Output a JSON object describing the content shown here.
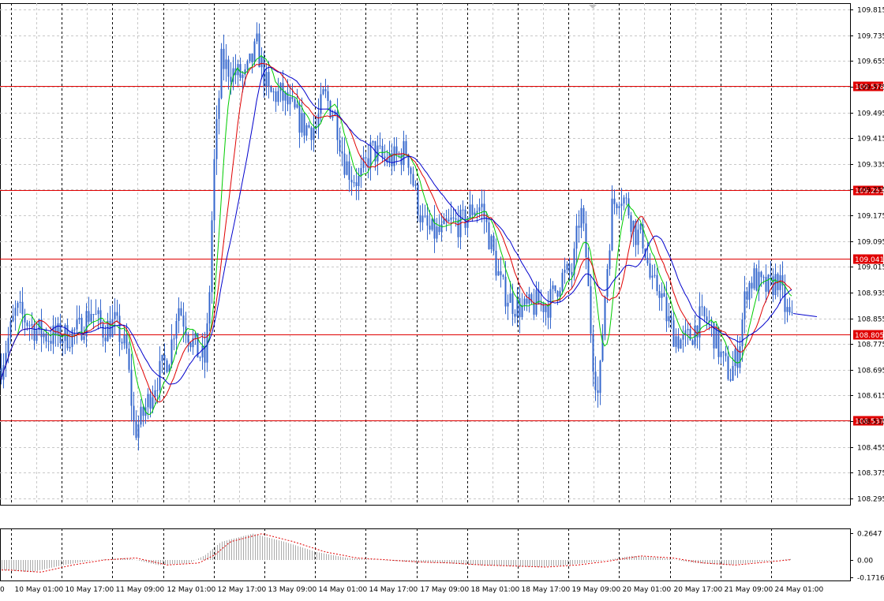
{
  "chart_data": [
    {
      "type": "candlestick",
      "instrument": "",
      "ylim": [
        108.295,
        109.815
      ],
      "y_ticks": [
        "109.815",
        "109.735",
        "109.655",
        "109.575",
        "109.495",
        "109.415",
        "109.335",
        "109.255",
        "109.175",
        "109.095",
        "109.015",
        "108.935",
        "108.855",
        "108.775",
        "108.695",
        "108.615",
        "108.535",
        "108.455",
        "108.375",
        "108.295"
      ],
      "x_tick_labels": [
        "10 May 01:00",
        "10 May 17:00",
        "11 May 09:00",
        "12 May 01:00",
        "12 May 17:00",
        "13 May 09:00",
        "14 May 01:00",
        "14 May 17:00",
        "17 May 09:00",
        "18 May 01:00",
        "18 May 17:00",
        "19 May 09:00",
        "20 May 01:00",
        "20 May 17:00",
        "21 May 09:00",
        "24 May 01:00"
      ],
      "x_first_partial_label": "0",
      "horizontal_levels": [
        {
          "value": "109.578",
          "color": "#e00000"
        },
        {
          "value": "109.253",
          "color": "#e00000"
        },
        {
          "value": "109.041",
          "color": "#e00000"
        },
        {
          "value": "108.805",
          "color": "#e00000"
        },
        {
          "value": "108.537",
          "color": "#e00000"
        }
      ],
      "price_anchors": [
        [
          0,
          108.7
        ],
        [
          20,
          108.88
        ],
        [
          45,
          108.82
        ],
        [
          60,
          108.8
        ],
        [
          85,
          108.8
        ],
        [
          100,
          108.82
        ],
        [
          115,
          108.88
        ],
        [
          130,
          108.82
        ],
        [
          145,
          108.84
        ],
        [
          160,
          108.75
        ],
        [
          170,
          108.5
        ],
        [
          180,
          108.55
        ],
        [
          195,
          108.65
        ],
        [
          205,
          108.7
        ],
        [
          215,
          108.75
        ],
        [
          225,
          108.9
        ],
        [
          240,
          108.8
        ],
        [
          250,
          108.75
        ],
        [
          260,
          108.72
        ],
        [
          265,
          108.95
        ],
        [
          270,
          109.3
        ],
        [
          280,
          109.65
        ],
        [
          295,
          109.62
        ],
        [
          310,
          109.6
        ],
        [
          325,
          109.7
        ],
        [
          340,
          109.55
        ],
        [
          355,
          109.55
        ],
        [
          370,
          109.5
        ],
        [
          385,
          109.45
        ],
        [
          400,
          109.45
        ],
        [
          410,
          109.55
        ],
        [
          425,
          109.48
        ],
        [
          435,
          109.35
        ],
        [
          445,
          109.3
        ],
        [
          455,
          109.28
        ],
        [
          470,
          109.38
        ],
        [
          485,
          109.35
        ],
        [
          500,
          109.35
        ],
        [
          515,
          109.38
        ],
        [
          525,
          109.25
        ],
        [
          535,
          109.15
        ],
        [
          545,
          109.12
        ],
        [
          560,
          109.12
        ],
        [
          570,
          109.15
        ],
        [
          585,
          109.15
        ],
        [
          600,
          109.2
        ],
        [
          610,
          109.2
        ],
        [
          620,
          109.1
        ],
        [
          635,
          108.95
        ],
        [
          650,
          108.9
        ],
        [
          665,
          108.88
        ],
        [
          680,
          108.9
        ],
        [
          695,
          108.9
        ],
        [
          710,
          108.98
        ],
        [
          725,
          109.0
        ],
        [
          735,
          109.2
        ],
        [
          742,
          109.05
        ],
        [
          750,
          108.75
        ],
        [
          758,
          108.6
        ],
        [
          765,
          108.9
        ],
        [
          775,
          109.2
        ],
        [
          785,
          109.25
        ],
        [
          795,
          109.2
        ],
        [
          805,
          109.12
        ],
        [
          815,
          109.1
        ],
        [
          825,
          108.95
        ],
        [
          835,
          108.95
        ],
        [
          845,
          108.85
        ],
        [
          855,
          108.8
        ],
        [
          865,
          108.78
        ],
        [
          875,
          108.8
        ],
        [
          885,
          108.85
        ],
        [
          895,
          108.85
        ],
        [
          905,
          108.8
        ],
        [
          915,
          108.72
        ],
        [
          925,
          108.68
        ],
        [
          935,
          108.75
        ],
        [
          945,
          108.95
        ],
        [
          955,
          108.98
        ],
        [
          965,
          108.95
        ],
        [
          975,
          108.95
        ],
        [
          985,
          108.98
        ],
        [
          995,
          108.88
        ],
        [
          1005,
          108.83
        ]
      ],
      "sma_fast_color": "#00cc00",
      "sma_mid_color": "#e00000",
      "sma_slow_color": "#0000cc",
      "candle_color": "#3366cc",
      "grid": true,
      "grid_style": "dashed"
    },
    {
      "type": "histogram",
      "name": "",
      "ylim": [
        -0.1716,
        0.2647
      ],
      "y_ticks": [
        "0.2647",
        "0.00",
        "-0.1716"
      ],
      "signal_color": "#e00000",
      "bar_color": "#aaaaaa",
      "values_anchors": [
        [
          0,
          -0.1
        ],
        [
          40,
          -0.12
        ],
        [
          80,
          -0.05
        ],
        [
          120,
          0.0
        ],
        [
          160,
          0.02
        ],
        [
          200,
          -0.05
        ],
        [
          240,
          -0.03
        ],
        [
          260,
          0.05
        ],
        [
          280,
          0.18
        ],
        [
          320,
          0.26
        ],
        [
          360,
          0.18
        ],
        [
          400,
          0.08
        ],
        [
          440,
          0.02
        ],
        [
          480,
          0.0
        ],
        [
          520,
          -0.02
        ],
        [
          560,
          -0.03
        ],
        [
          600,
          -0.05
        ],
        [
          640,
          -0.06
        ],
        [
          680,
          -0.07
        ],
        [
          720,
          -0.05
        ],
        [
          760,
          -0.01
        ],
        [
          800,
          0.04
        ],
        [
          840,
          0.02
        ],
        [
          880,
          -0.03
        ],
        [
          920,
          -0.05
        ],
        [
          960,
          -0.02
        ],
        [
          1000,
          0.01
        ]
      ]
    }
  ]
}
